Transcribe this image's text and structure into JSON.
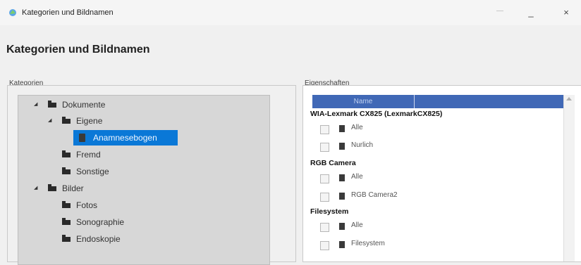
{
  "window": {
    "title": "Kategorien und Bildnamen",
    "minimize_glyph": "_",
    "close_glyph": "×",
    "restore_glyph": "—"
  },
  "page": {
    "heading": "Kategorien und Bildnamen"
  },
  "left_panel": {
    "label": "Kategorien",
    "tree": [
      {
        "label": "Dokumente",
        "expanded": true,
        "level": 0
      },
      {
        "label": "Eigene",
        "expanded": true,
        "level": 1
      },
      {
        "label": "Anamnesebogen",
        "level": 2,
        "selected": true
      },
      {
        "label": "Fremd",
        "level": 1
      },
      {
        "label": "Sonstige",
        "level": 1
      },
      {
        "label": "Bilder",
        "expanded": true,
        "level": 0
      },
      {
        "label": "Fotos",
        "level": 1
      },
      {
        "label": "Sonographie",
        "level": 1
      },
      {
        "label": "Endoskopie",
        "level": 1
      }
    ]
  },
  "right_panel": {
    "label": "Eigenschaften",
    "column_header": "Name",
    "groups": [
      {
        "name": "WIA-Lexmark CX825 (LexmarkCX825)",
        "items": [
          "Alle",
          "Nurlich"
        ]
      },
      {
        "name": "RGB Camera",
        "items": [
          "Alle",
          "RGB Camera2"
        ]
      },
      {
        "name": "Filesystem",
        "items": [
          "Alle",
          "Filesystem"
        ]
      }
    ]
  },
  "colors": {
    "accent": "#0a78d7",
    "header_blue": "#4068b6"
  }
}
